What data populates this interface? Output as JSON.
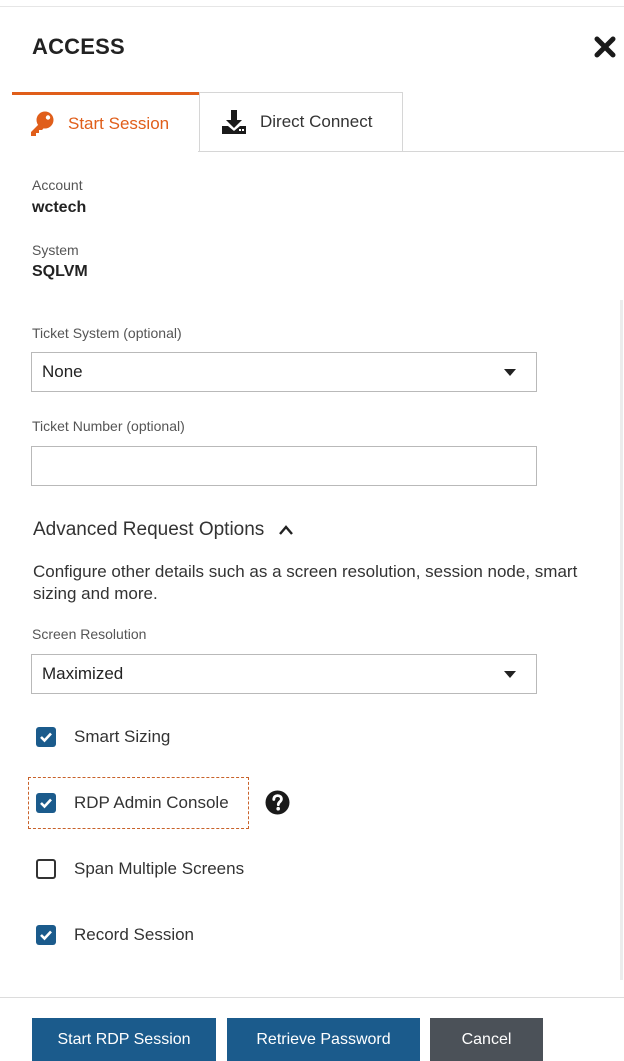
{
  "panel": {
    "title": "ACCESS"
  },
  "tabs": [
    {
      "label": "Start Session",
      "icon": "key-icon",
      "active": true
    },
    {
      "label": "Direct Connect",
      "icon": "download-icon",
      "active": false
    }
  ],
  "account": {
    "label": "Account",
    "value": "wctech"
  },
  "system": {
    "label": "System",
    "value": "SQLVM"
  },
  "ticket_system": {
    "label": "Ticket System (optional)",
    "value": "None"
  },
  "ticket_number": {
    "label": "Ticket Number (optional)",
    "value": "",
    "placeholder": ""
  },
  "advanced": {
    "title": "Advanced Request Options",
    "description": "Configure other details such as a screen resolution, session node, smart sizing and more."
  },
  "screen_resolution": {
    "label": "Screen Resolution",
    "value": "Maximized"
  },
  "options": [
    {
      "label": "Smart Sizing",
      "checked": true
    },
    {
      "label": "RDP Admin Console",
      "checked": true
    },
    {
      "label": "Span Multiple Screens",
      "checked": false
    },
    {
      "label": "Record Session",
      "checked": true
    }
  ],
  "buttons": {
    "start": "Start RDP Session",
    "retrieve": "Retrieve Password",
    "cancel": "Cancel"
  },
  "colors": {
    "accent": "#e05e1a",
    "primary": "#1b5b8c",
    "secondary": "#4b5158"
  }
}
